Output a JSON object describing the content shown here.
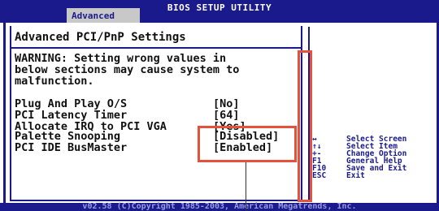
{
  "header": {
    "title": "BIOS SETUP UTILITY",
    "active_tab": "Advanced"
  },
  "main": {
    "heading": "Advanced PCI/PnP Settings",
    "warning": "WARNING: Setting wrong values in\nbelow sections may cause system to\nmalfunction.",
    "options": [
      {
        "label": "Plug And Play O/S",
        "value": "[No]"
      },
      {
        "label": "PCI Latency Timer",
        "value": "[64]"
      },
      {
        "label": "Allocate IRQ to PCI VGA",
        "value": "[Yes]"
      },
      {
        "label": "Palette Snooping",
        "value": "[Disabled]"
      },
      {
        "label": "PCI IDE BusMaster",
        "value": "[Enabled]"
      }
    ]
  },
  "help": [
    {
      "key": "↔",
      "desc": "Select Screen",
      "icon": "left-right-arrow-icon"
    },
    {
      "key": "↑↓",
      "desc": "Select Item",
      "icon": "up-down-arrow-icon"
    },
    {
      "key": "+-",
      "desc": "Change Option",
      "icon": "plus-minus-icon"
    },
    {
      "key": "F1",
      "desc": "General Help"
    },
    {
      "key": "F10",
      "desc": "Save and Exit"
    },
    {
      "key": "ESC",
      "desc": "Exit"
    }
  ],
  "footer": "v02.58 (C)Copyright 1985-2003, American Megatrends, Inc.",
  "colors": {
    "bios_blue": "#1a1a8c",
    "callout_red": "#e5513a",
    "tab_gray": "#c8c8c8"
  }
}
